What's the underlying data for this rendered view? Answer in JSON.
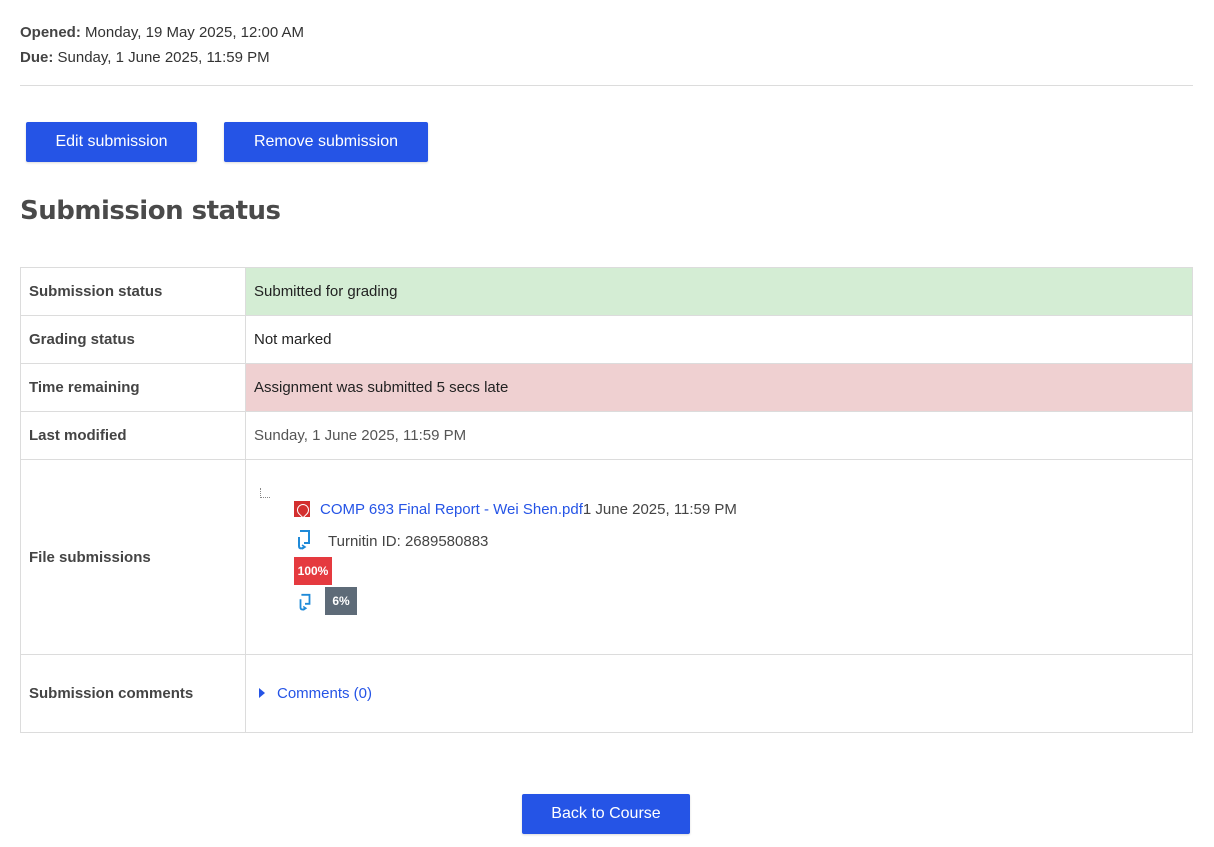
{
  "dates": {
    "opened_label": "Opened:",
    "opened_value": "Monday, 19 May 2025, 12:00 AM",
    "due_label": "Due:",
    "due_value": "Sunday, 1 June 2025, 11:59 PM"
  },
  "actions": {
    "edit_label": "Edit submission",
    "remove_label": "Remove submission"
  },
  "section_title": "Submission status",
  "status_table": {
    "submission_status_label": "Submission status",
    "submission_status_value": "Submitted for grading",
    "grading_status_label": "Grading status",
    "grading_status_value": "Not marked",
    "time_remaining_label": "Time remaining",
    "time_remaining_value": "Assignment was submitted 5 secs late",
    "last_modified_label": "Last modified",
    "last_modified_value": "Sunday, 1 June 2025, 11:59 PM",
    "file_submissions_label": "File submissions",
    "file_name": "COMP 693 Final Report - Wei Shen.pdf",
    "file_date": "1 June 2025, 11:59 PM",
    "turnitin_id": "Turnitin ID: 2689580883",
    "similarity_badge_1": "100%",
    "similarity_badge_2": "6%",
    "submission_comments_label": "Submission comments",
    "comments_link": "Comments (0)"
  },
  "footer": {
    "back_label": "Back to Course"
  },
  "colors": {
    "primary": "#2554e6",
    "submitted_bg": "#d4edd4",
    "late_bg": "#efd0d1",
    "badge_red": "#e53a3f",
    "badge_grey": "#5e6b78"
  },
  "icons": {
    "file_icon": "pdf-icon",
    "turnitin_icon": "turnitin-icon",
    "expand_icon": "caret-right-icon"
  }
}
